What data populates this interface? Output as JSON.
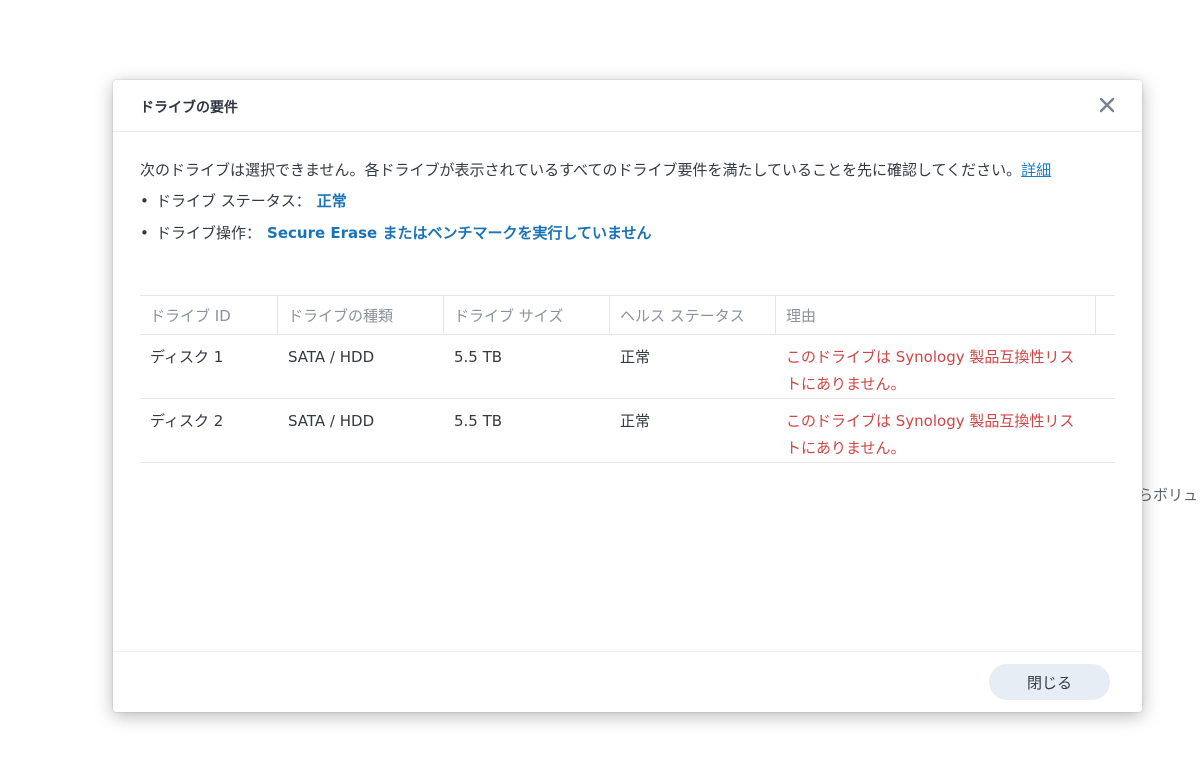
{
  "background": {
    "partial_text": "らボリュ"
  },
  "dialog": {
    "title": "ドライブの要件",
    "close_icon": "close-x-icon",
    "intro_text": "次のドライブは選択できません。各ドライブが表示されているすべてのドライブ要件を満たしていることを先に確認してください。",
    "details_link": "詳細",
    "requirements": [
      {
        "label": "ドライブ ステータス：",
        "value": "正常"
      },
      {
        "label": "ドライブ操作：",
        "value": "Secure Erase またはベンチマークを実行していません"
      }
    ],
    "table": {
      "headers": [
        "ドライブ ID",
        "ドライブの種類",
        "ドライブ サイズ",
        "ヘルス ステータス",
        "理由"
      ],
      "rows": [
        {
          "id": "ディスク 1",
          "type": "SATA / HDD",
          "size": "5.5 TB",
          "health": "正常",
          "reason": "このドライブは Synology 製品互換性リストにありません。"
        },
        {
          "id": "ディスク 2",
          "type": "SATA / HDD",
          "size": "5.5 TB",
          "health": "正常",
          "reason": "このドライブは Synology 製品互換性リストにありません。"
        }
      ]
    },
    "close_button_label": "閉じる"
  },
  "colors": {
    "link": "#1a82c9",
    "requirement_value": "#1a73b8",
    "error_reason": "#d04545",
    "button_bg": "#e7edf4"
  }
}
